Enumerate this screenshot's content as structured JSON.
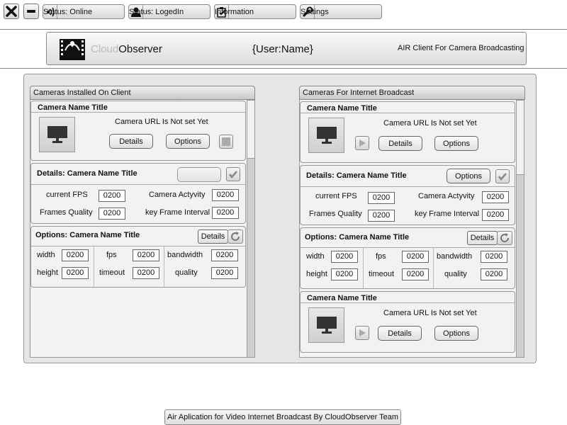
{
  "toolbar": {
    "close_icon": "close-icon",
    "minimize_icon": "minimize-icon",
    "status_online": "Status: Online",
    "status_logged": "Status: LogedIn",
    "information": "Information",
    "settings": "Settings"
  },
  "header": {
    "brand_cloud": "Cloud",
    "brand_observer": "Observer",
    "username": "{User:Name}",
    "tagline": "AIR Client For Camera Broadcasting"
  },
  "left_column": {
    "title": "Cameras Installed On Client",
    "camera": {
      "title": "Camera Name Title",
      "url": "Camera URL Is Not set Yet",
      "details": "Details",
      "options": "Options"
    },
    "details": {
      "title": "Details: Camera Name Title",
      "current_fps_label": "current FPS",
      "current_fps": "0200",
      "activity_label": "Camera Actyvity",
      "activity": "0200",
      "quality_label": "Frames Quality",
      "quality": "0200",
      "keyframe_label": "key Frame Interval",
      "keyframe": "0200"
    },
    "options": {
      "title": "Options: Camera Name Title",
      "details_button": "Details",
      "width_label": "width",
      "width": "0200",
      "height_label": "height",
      "height": "0200",
      "fps_label": "fps",
      "fps": "0200",
      "timeout_label": "timeout",
      "timeout": "0200",
      "bandwidth_label": "bandwidth",
      "bandwidth": "0200",
      "quality_label": "quality",
      "quality": "0200"
    }
  },
  "right_column": {
    "title": "Cameras For Internet Broadcast",
    "camera1": {
      "title": "Camera Name Title",
      "url": "Camera URL Is Not set Yet",
      "details": "Details",
      "options": "Options"
    },
    "details": {
      "title": "Details: Camera Name Title",
      "options_button": "Options",
      "current_fps_label": "current FPS",
      "current_fps": "0200",
      "activity_label": "Camera Actyvity",
      "activity": "0200",
      "quality_label": "Frames Quality",
      "quality": "0200",
      "keyframe_label": "key Frame Interval",
      "keyframe": "0200"
    },
    "options": {
      "title": "Options: Camera Name Title",
      "details_button": "Details",
      "width_label": "width",
      "width": "0200",
      "height_label": "height",
      "height": "0200",
      "fps_label": "fps",
      "fps": "0200",
      "timeout_label": "timeout",
      "timeout": "0200",
      "bandwidth_label": "bandwidth",
      "bandwidth": "0200",
      "quality_label": "quality",
      "quality": "0200"
    },
    "camera2": {
      "title": "Camera Name Title",
      "url": "Camera URL Is Not set Yet",
      "details": "Details",
      "options": "Options"
    }
  },
  "footer": {
    "text": "Air Aplication for Video Internet Broadcast By CloudObserver Team"
  }
}
